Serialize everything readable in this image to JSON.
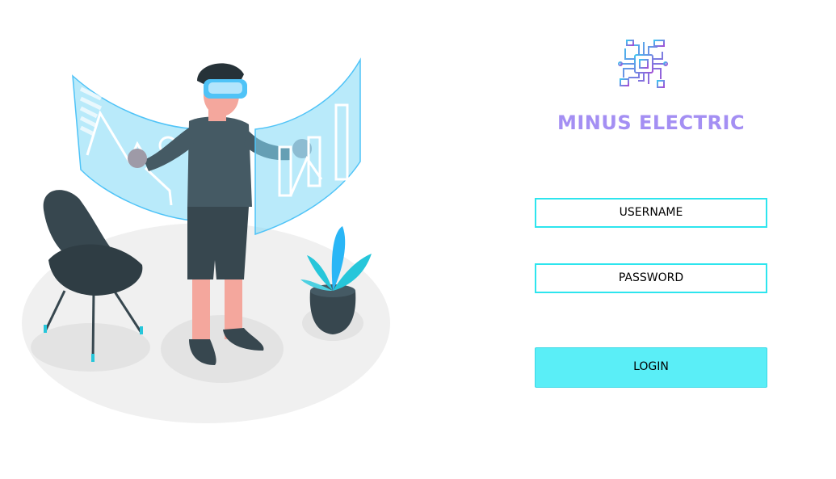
{
  "brand": {
    "name": "MINUS ELECTRIC",
    "logo_icon": "circuit-chip-icon",
    "color": "#a48ff3"
  },
  "form": {
    "username_label": "USERNAME",
    "password_label": "PASSWORD",
    "login_label": "LOGIN",
    "field_border_color": "#2de5ee",
    "button_color": "#5aeef7"
  },
  "illustration": {
    "subject": "vr-user-illustration"
  }
}
